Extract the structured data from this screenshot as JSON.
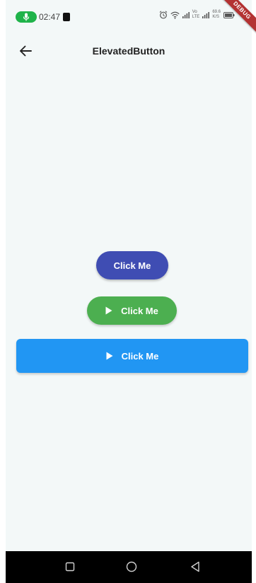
{
  "status_bar": {
    "time": "02:47",
    "speed_value": "69.6",
    "speed_unit": "K/S",
    "network_label_1": "Vo",
    "network_label_2": "LTE"
  },
  "debug_banner": {
    "label": "DEBUG"
  },
  "app_bar": {
    "title": "ElevatedButton"
  },
  "buttons": [
    {
      "label": "Click Me",
      "color": "#3f4db3",
      "icon": null
    },
    {
      "label": "Click Me",
      "color": "#4caf50",
      "icon": "play-icon"
    },
    {
      "label": "Click Me",
      "color": "#2196f3",
      "icon": "play-icon"
    }
  ],
  "colors": {
    "background": "#f3f8f8",
    "mic_pill": "#1fb34a",
    "nav_bar": "#000000",
    "debug_ribbon": "#b33232"
  },
  "nav_bar": {
    "icons": [
      "recent-apps-icon",
      "home-icon",
      "back-icon"
    ]
  }
}
